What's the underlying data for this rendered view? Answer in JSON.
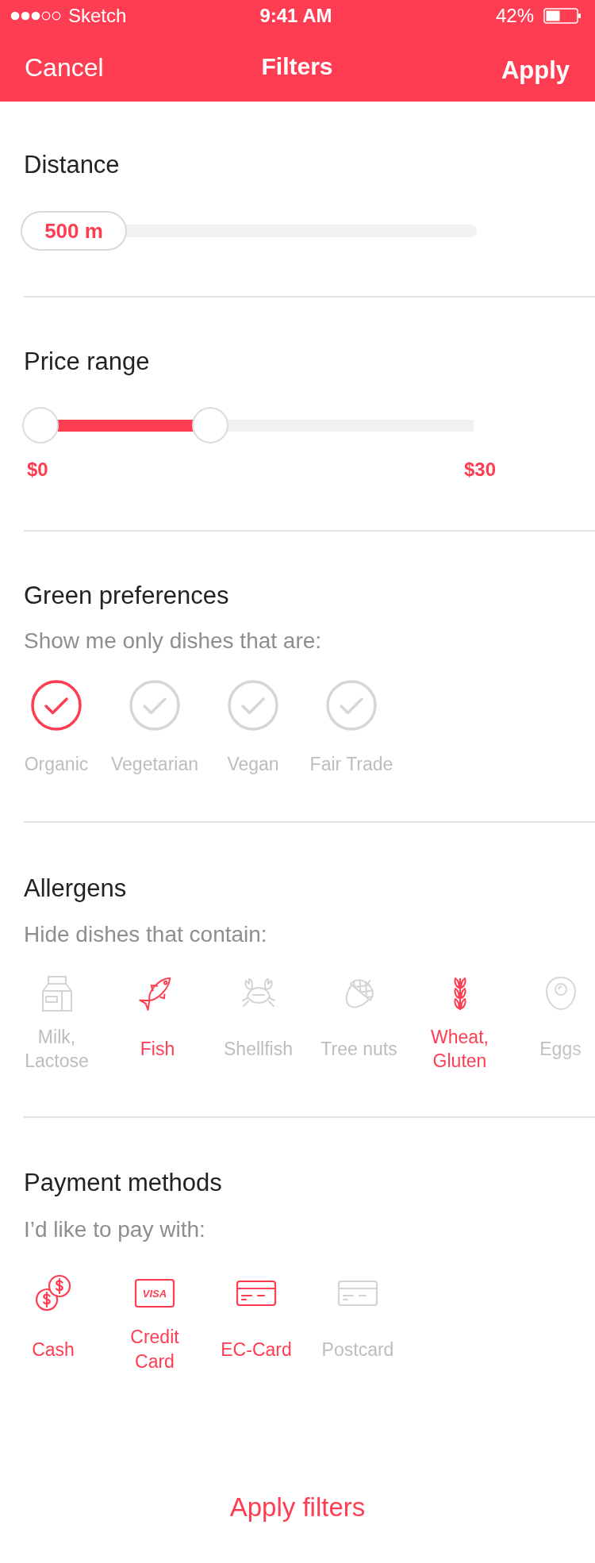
{
  "status_bar": {
    "carrier": "Sketch",
    "time": "9:41 AM",
    "battery": "42%"
  },
  "nav": {
    "cancel": "Cancel",
    "title": "Filters",
    "apply": "Apply"
  },
  "distance": {
    "title": "Distance",
    "value": "500 m",
    "level": 0
  },
  "price_range": {
    "title": "Price range",
    "thumbs": [
      {
        "level": 0
      },
      {
        "level": 0.41
      }
    ],
    "min_label": "$0",
    "max_label": "$30"
  },
  "green_preferences": {
    "title": "Green preferences",
    "subtitle": "Show me only dishes that are:",
    "items": [
      {
        "label": "Organic",
        "selected": true
      },
      {
        "label": "Vegetarian",
        "selected": false
      },
      {
        "label": "Vegan",
        "selected": false
      },
      {
        "label": "Fair Trade",
        "selected": false
      }
    ]
  },
  "allergens": {
    "title": "Allergens",
    "subtitle": "Hide dishes that contain:",
    "items": [
      {
        "label": "Milk, Lactose",
        "selected": false
      },
      {
        "label": "Fish",
        "selected": true
      },
      {
        "label": "Shellfish",
        "selected": false
      },
      {
        "label": "Tree nuts",
        "selected": false
      },
      {
        "label": "Wheat, Gluten",
        "selected": true
      },
      {
        "label": "Eggs",
        "selected": false
      }
    ]
  },
  "payment_methods": {
    "title": "Payment methods",
    "subtitle": "I’d like to pay with:",
    "items": [
      {
        "label": "Cash",
        "selected": true
      },
      {
        "label": "Credit Card",
        "selected": true,
        "icon_text": "VISA"
      },
      {
        "label": "EC-Card",
        "selected": true
      },
      {
        "label": "Postcard",
        "selected": false
      }
    ]
  },
  "apply_button": "Apply filters"
}
